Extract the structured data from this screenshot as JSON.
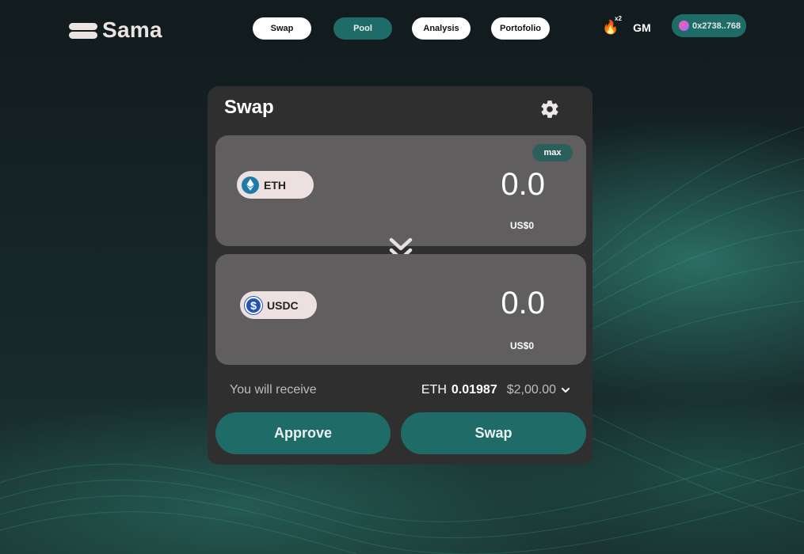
{
  "brand": {
    "name": "Sama"
  },
  "nav": {
    "items": [
      {
        "label": "Swap",
        "active": false
      },
      {
        "label": "Pool",
        "active": true
      },
      {
        "label": "Analysis",
        "active": false
      },
      {
        "label": "Portofolio",
        "active": false
      }
    ]
  },
  "status": {
    "streak_multiplier": "x2",
    "greeting": "GM"
  },
  "wallet": {
    "address": "0x2738..768"
  },
  "swap": {
    "title": "Swap",
    "settings_icon": "gear-icon",
    "from": {
      "token": "ETH",
      "amount": "0.0",
      "usd": "US$0",
      "max_label": "max"
    },
    "to": {
      "token": "USDC",
      "amount": "0.0",
      "usd": "US$0"
    },
    "switch_icon": "double-chevron-down-icon",
    "receive": {
      "label": "You will receive",
      "token": "ETH",
      "amount": "0.01987",
      "usd": "$2,00.00"
    },
    "approve_label": "Approve",
    "swap_label": "Swap"
  },
  "colors": {
    "accent": "#1e6b67",
    "card": "#2f2f2f",
    "panel": "#605e5e",
    "pill": "#ece0e0"
  }
}
